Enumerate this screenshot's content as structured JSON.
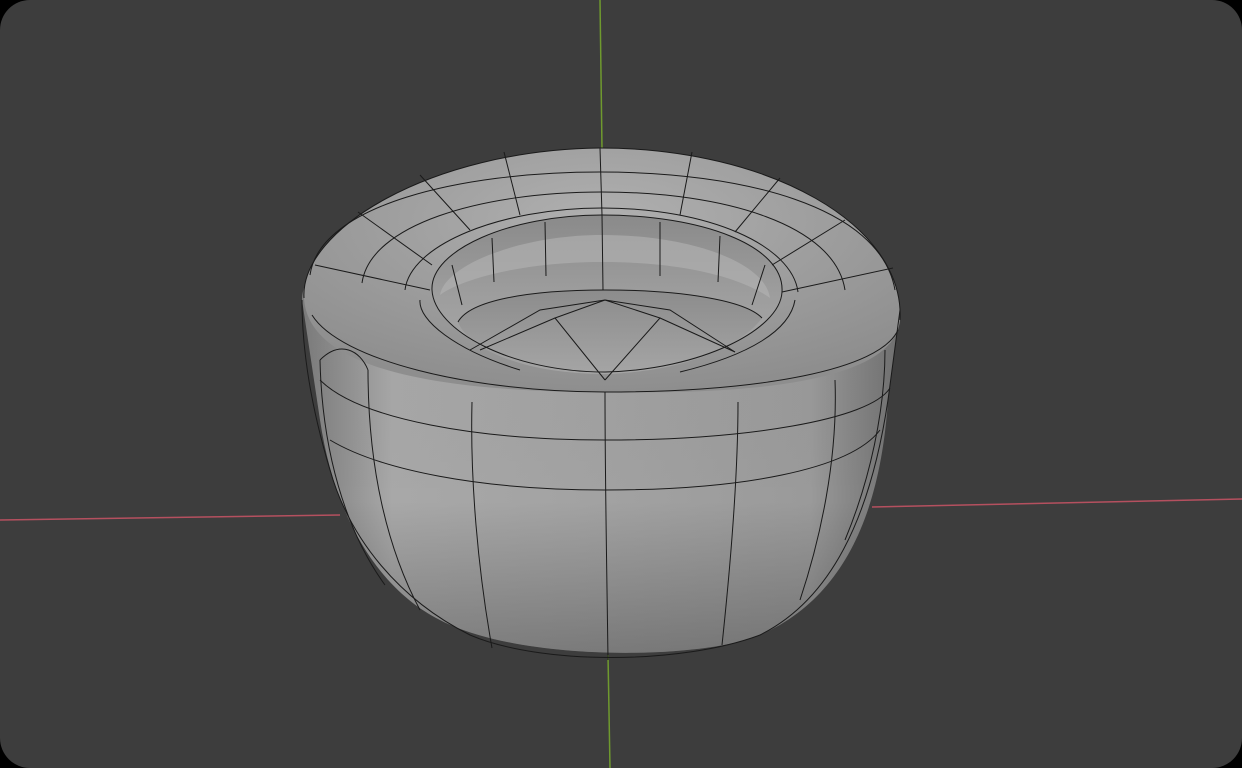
{
  "viewport": {
    "background_color": "#3d3d3d",
    "x_axis_color": "#b5505f",
    "y_axis_color": "#6f9a2e",
    "mesh_fill_color": "#9a9a9a",
    "mesh_highlight_color": "#bdbdbd",
    "mesh_shadow_color": "#5e5e5e",
    "wire_color": "#1a1a1a"
  },
  "object": {
    "icon": "subdivided-torus-cup-mesh-icon"
  }
}
